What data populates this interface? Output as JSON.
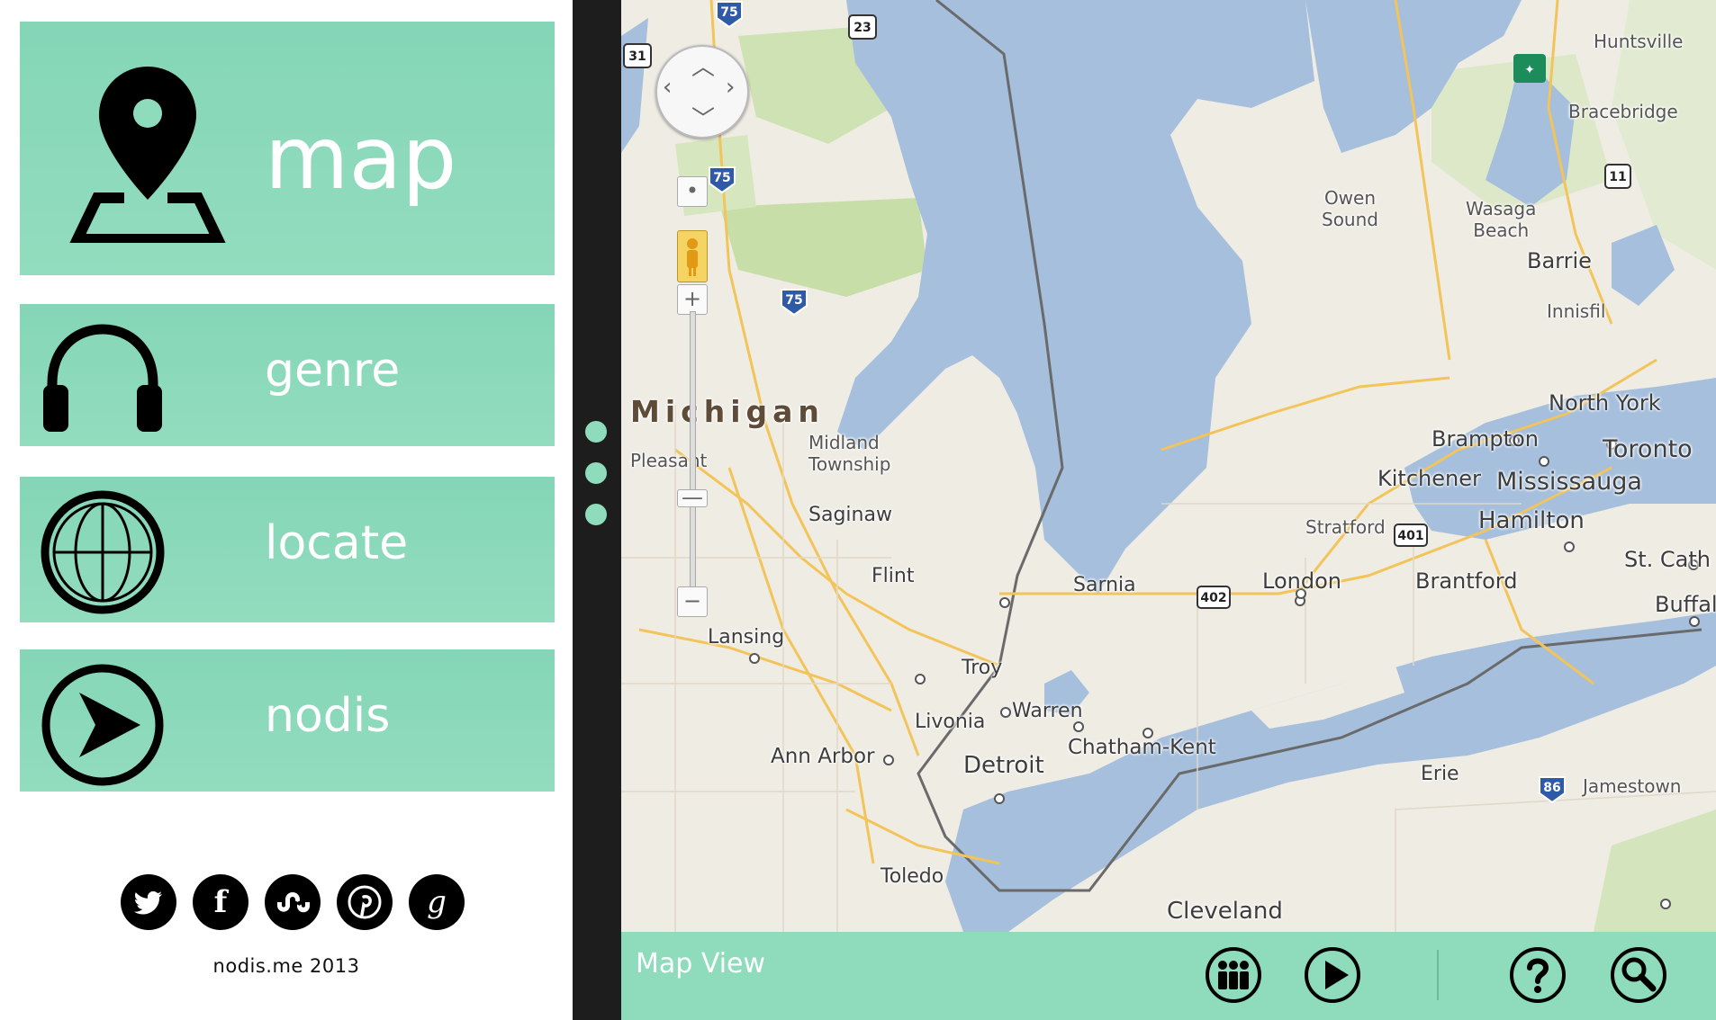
{
  "sidebar": {
    "menu": [
      {
        "id": "map",
        "label": "map",
        "icon": "map-pin-icon"
      },
      {
        "id": "genre",
        "label": "genre",
        "icon": "headphones-icon"
      },
      {
        "id": "locate",
        "label": "locate",
        "icon": "globe-icon"
      },
      {
        "id": "nodis",
        "label": "nodis",
        "icon": "play-arrow-circle-icon"
      }
    ],
    "social": [
      {
        "name": "twitter",
        "icon": "twitter-icon",
        "glyph": ""
      },
      {
        "name": "facebook",
        "icon": "facebook-icon",
        "glyph": "f"
      },
      {
        "name": "stumbleupon",
        "icon": "stumbleupon-icon",
        "glyph": ""
      },
      {
        "name": "pinterest",
        "icon": "pinterest-icon",
        "glyph": "P"
      },
      {
        "name": "google",
        "icon": "google-icon",
        "glyph": "g"
      }
    ],
    "copyright": "nodis.me 2013"
  },
  "colors": {
    "accent": "#8fdcbd",
    "divider": "#1d1d1d",
    "water": "#a5bfdd",
    "land": "#efece4"
  },
  "map": {
    "state_label": "Michigan",
    "places": {
      "huntsville": "Huntsville",
      "bracebridge": "Bracebridge",
      "owen_sound": "Owen\nSound",
      "wasaga": "Wasaga\nBeach",
      "barrie": "Barrie",
      "innisfil": "Innisfil",
      "north_york": "North York",
      "brampton": "Brampton",
      "toronto": "Toronto",
      "kitchener": "Kitchener",
      "mississauga": "Mississauga",
      "stratford": "Stratford",
      "hamilton": "Hamilton",
      "st_cath": "St. Cath",
      "brantford": "Brantford",
      "london": "London",
      "buffalo": "Buffal",
      "sarnia": "Sarnia",
      "midland": "Midland\nTownship",
      "pleasant": "Pleasant",
      "saginaw": "Saginaw",
      "flint": "Flint",
      "lansing": "Lansing",
      "troy": "Troy",
      "warren": "Warren",
      "livonia": "Livonia",
      "chatham": "Chatham-Kent",
      "ann_arbor": "Ann Arbor",
      "detroit": "Detroit",
      "erie": "Erie",
      "jamestown": "Jamestown",
      "toledo": "Toledo",
      "cleveland": "Cleveland"
    },
    "shields": [
      "75",
      "23",
      "31",
      "75",
      "75",
      "11",
      "401",
      "402",
      "86"
    ],
    "controls": {
      "zoom_in": "+",
      "zoom_out": "−"
    }
  },
  "bottombar": {
    "title": "Map View",
    "buttons": [
      {
        "name": "people-button",
        "icon": "people-icon"
      },
      {
        "name": "play-button",
        "icon": "play-icon"
      },
      {
        "name": "help-button",
        "icon": "help-icon"
      },
      {
        "name": "search-button",
        "icon": "search-icon"
      }
    ]
  }
}
